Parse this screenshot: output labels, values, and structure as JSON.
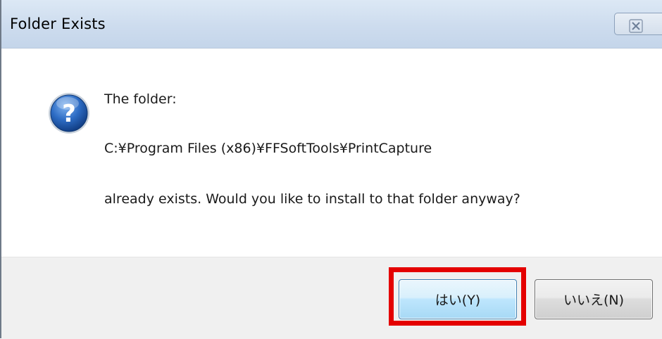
{
  "window": {
    "title": "Folder Exists",
    "close_glyph": "☒",
    "close_icon": "close-icon"
  },
  "message": {
    "icon": "question-icon",
    "line1": "The folder:",
    "line2": "C:¥Program Files (x86)¥FFSoftTools¥PrintCapture",
    "line3": "already exists. Would you like to install to that folder anyway?"
  },
  "buttons": {
    "yes_label": "はい(Y)",
    "no_label": "いいえ(N)"
  },
  "annotation": {
    "highlight_color": "#e40000",
    "highlight_target": "yes-button"
  },
  "colors": {
    "titlebar": "#cddcee",
    "footer": "#f0f0f0",
    "icon_blue": "#1f5fb8",
    "default_button_border": "#3c7fb1"
  }
}
